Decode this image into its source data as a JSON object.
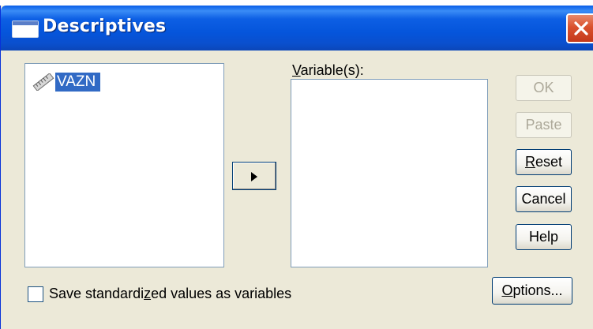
{
  "window": {
    "title": "Descriptives"
  },
  "source_list": {
    "items": [
      {
        "label": "VAZN",
        "icon": "ruler-scale-icon",
        "selected": true
      }
    ]
  },
  "target_list": {
    "label_pre": "",
    "label_accel": "V",
    "label_post": "ariable(s):",
    "items": []
  },
  "buttons": {
    "ok": {
      "label": "OK",
      "enabled": false
    },
    "paste": {
      "label": "Paste",
      "enabled": false
    },
    "reset": {
      "accel": "R",
      "rest": "eset"
    },
    "cancel": {
      "label": "Cancel"
    },
    "help": {
      "label": "Help"
    },
    "options": {
      "accel": "O",
      "rest": "ptions..."
    }
  },
  "checkbox": {
    "label_pre": "Save standardi",
    "label_accel": "z",
    "label_post": "ed values as variables",
    "checked": false
  },
  "colors": {
    "titlebar": "#0555db",
    "selection": "#316ac5",
    "face": "#ece9d8"
  }
}
